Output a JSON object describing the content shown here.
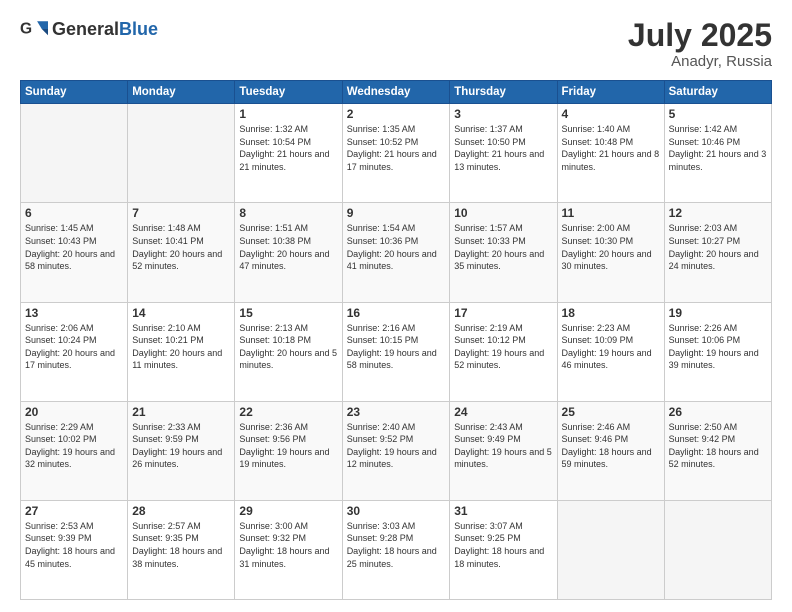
{
  "header": {
    "logo_general": "General",
    "logo_blue": "Blue",
    "month": "July 2025",
    "location": "Anadyr, Russia"
  },
  "weekdays": [
    "Sunday",
    "Monday",
    "Tuesday",
    "Wednesday",
    "Thursday",
    "Friday",
    "Saturday"
  ],
  "weeks": [
    [
      {
        "day": "",
        "info": ""
      },
      {
        "day": "",
        "info": ""
      },
      {
        "day": "1",
        "info": "Sunrise: 1:32 AM\nSunset: 10:54 PM\nDaylight: 21 hours and 21 minutes."
      },
      {
        "day": "2",
        "info": "Sunrise: 1:35 AM\nSunset: 10:52 PM\nDaylight: 21 hours and 17 minutes."
      },
      {
        "day": "3",
        "info": "Sunrise: 1:37 AM\nSunset: 10:50 PM\nDaylight: 21 hours and 13 minutes."
      },
      {
        "day": "4",
        "info": "Sunrise: 1:40 AM\nSunset: 10:48 PM\nDaylight: 21 hours and 8 minutes."
      },
      {
        "day": "5",
        "info": "Sunrise: 1:42 AM\nSunset: 10:46 PM\nDaylight: 21 hours and 3 minutes."
      }
    ],
    [
      {
        "day": "6",
        "info": "Sunrise: 1:45 AM\nSunset: 10:43 PM\nDaylight: 20 hours and 58 minutes."
      },
      {
        "day": "7",
        "info": "Sunrise: 1:48 AM\nSunset: 10:41 PM\nDaylight: 20 hours and 52 minutes."
      },
      {
        "day": "8",
        "info": "Sunrise: 1:51 AM\nSunset: 10:38 PM\nDaylight: 20 hours and 47 minutes."
      },
      {
        "day": "9",
        "info": "Sunrise: 1:54 AM\nSunset: 10:36 PM\nDaylight: 20 hours and 41 minutes."
      },
      {
        "day": "10",
        "info": "Sunrise: 1:57 AM\nSunset: 10:33 PM\nDaylight: 20 hours and 35 minutes."
      },
      {
        "day": "11",
        "info": "Sunrise: 2:00 AM\nSunset: 10:30 PM\nDaylight: 20 hours and 30 minutes."
      },
      {
        "day": "12",
        "info": "Sunrise: 2:03 AM\nSunset: 10:27 PM\nDaylight: 20 hours and 24 minutes."
      }
    ],
    [
      {
        "day": "13",
        "info": "Sunrise: 2:06 AM\nSunset: 10:24 PM\nDaylight: 20 hours and 17 minutes."
      },
      {
        "day": "14",
        "info": "Sunrise: 2:10 AM\nSunset: 10:21 PM\nDaylight: 20 hours and 11 minutes."
      },
      {
        "day": "15",
        "info": "Sunrise: 2:13 AM\nSunset: 10:18 PM\nDaylight: 20 hours and 5 minutes."
      },
      {
        "day": "16",
        "info": "Sunrise: 2:16 AM\nSunset: 10:15 PM\nDaylight: 19 hours and 58 minutes."
      },
      {
        "day": "17",
        "info": "Sunrise: 2:19 AM\nSunset: 10:12 PM\nDaylight: 19 hours and 52 minutes."
      },
      {
        "day": "18",
        "info": "Sunrise: 2:23 AM\nSunset: 10:09 PM\nDaylight: 19 hours and 46 minutes."
      },
      {
        "day": "19",
        "info": "Sunrise: 2:26 AM\nSunset: 10:06 PM\nDaylight: 19 hours and 39 minutes."
      }
    ],
    [
      {
        "day": "20",
        "info": "Sunrise: 2:29 AM\nSunset: 10:02 PM\nDaylight: 19 hours and 32 minutes."
      },
      {
        "day": "21",
        "info": "Sunrise: 2:33 AM\nSunset: 9:59 PM\nDaylight: 19 hours and 26 minutes."
      },
      {
        "day": "22",
        "info": "Sunrise: 2:36 AM\nSunset: 9:56 PM\nDaylight: 19 hours and 19 minutes."
      },
      {
        "day": "23",
        "info": "Sunrise: 2:40 AM\nSunset: 9:52 PM\nDaylight: 19 hours and 12 minutes."
      },
      {
        "day": "24",
        "info": "Sunrise: 2:43 AM\nSunset: 9:49 PM\nDaylight: 19 hours and 5 minutes."
      },
      {
        "day": "25",
        "info": "Sunrise: 2:46 AM\nSunset: 9:46 PM\nDaylight: 18 hours and 59 minutes."
      },
      {
        "day": "26",
        "info": "Sunrise: 2:50 AM\nSunset: 9:42 PM\nDaylight: 18 hours and 52 minutes."
      }
    ],
    [
      {
        "day": "27",
        "info": "Sunrise: 2:53 AM\nSunset: 9:39 PM\nDaylight: 18 hours and 45 minutes."
      },
      {
        "day": "28",
        "info": "Sunrise: 2:57 AM\nSunset: 9:35 PM\nDaylight: 18 hours and 38 minutes."
      },
      {
        "day": "29",
        "info": "Sunrise: 3:00 AM\nSunset: 9:32 PM\nDaylight: 18 hours and 31 minutes."
      },
      {
        "day": "30",
        "info": "Sunrise: 3:03 AM\nSunset: 9:28 PM\nDaylight: 18 hours and 25 minutes."
      },
      {
        "day": "31",
        "info": "Sunrise: 3:07 AM\nSunset: 9:25 PM\nDaylight: 18 hours and 18 minutes."
      },
      {
        "day": "",
        "info": ""
      },
      {
        "day": "",
        "info": ""
      }
    ]
  ]
}
